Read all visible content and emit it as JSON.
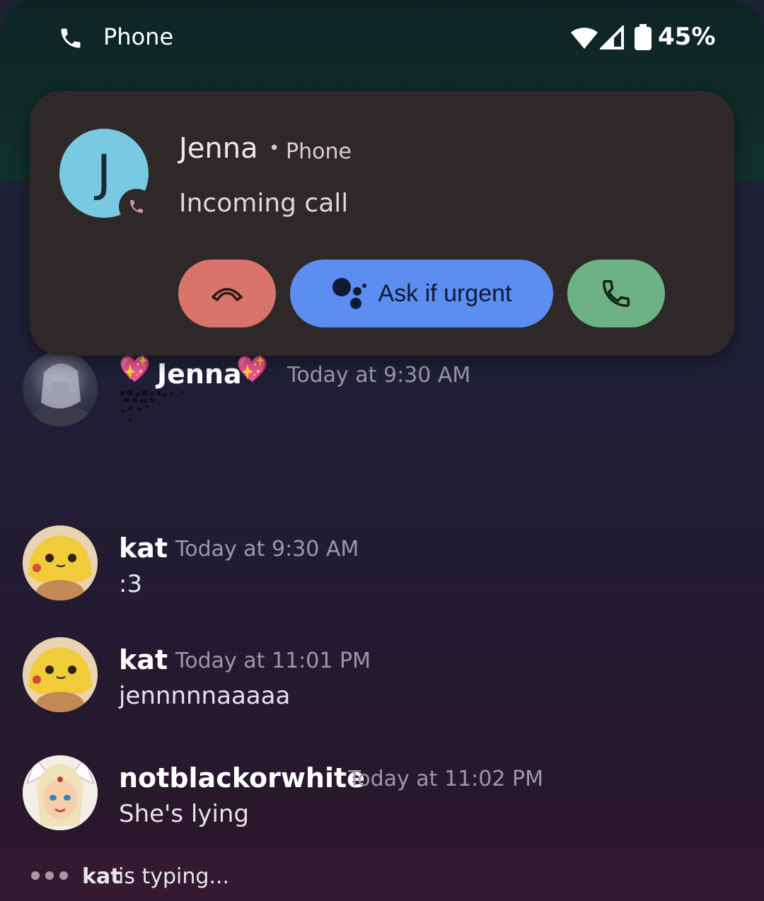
{
  "status_bar": {
    "app_label": "Phone",
    "battery_text": "45%"
  },
  "notification": {
    "avatar_letter": "J",
    "caller_name": "Jenna",
    "separator": "•",
    "app_name": "Phone",
    "status": "Incoming call",
    "urgent_label": "Ask if urgent"
  },
  "messages": [
    {
      "username": "Jenna",
      "username_emoji": "💖",
      "timestamp": "Today at 9:30 AM",
      "text": ""
    },
    {
      "username": "kat",
      "timestamp": "Today at 9:30 AM",
      "text": ":3"
    },
    {
      "username": "kat",
      "timestamp": "Today at 11:01 PM",
      "text": "jennnnnaaaaa"
    },
    {
      "username": "notblackorwhite",
      "timestamp": "Today at 11:02 PM",
      "text": "She's lying"
    }
  ],
  "typing": {
    "user": "kat",
    "text": "is typing..."
  },
  "colors": {
    "decline": "#d87469",
    "urgent": "#5b8ef0",
    "accept": "#6db284",
    "card": "#2f2829",
    "caller_avatar": "#79c9e2"
  }
}
